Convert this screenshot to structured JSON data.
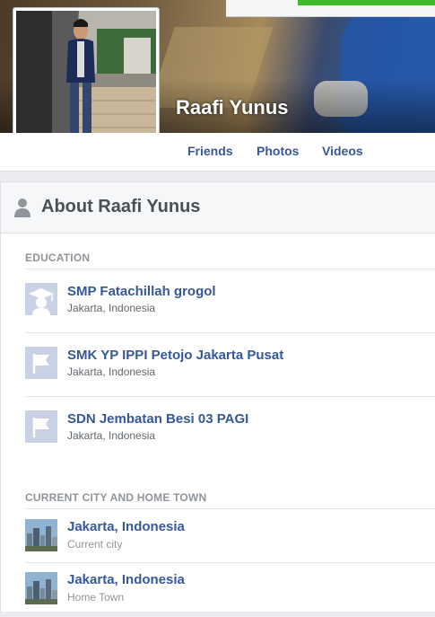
{
  "profile": {
    "name": "Raafi Yunus"
  },
  "nav": {
    "tabs": [
      {
        "label": "Friends"
      },
      {
        "label": "Photos"
      },
      {
        "label": "Videos"
      }
    ]
  },
  "about": {
    "title": "About Raafi Yunus",
    "education": {
      "heading": "EDUCATION",
      "items": [
        {
          "school": "SMP Fatachillah grogol",
          "location": "Jakarta, Indonesia",
          "icon": "graduate-icon"
        },
        {
          "school": "SMK YP IPPI Petojo Jakarta Pusat",
          "location": "Jakarta, Indonesia",
          "icon": "flag-icon"
        },
        {
          "school": "SDN Jembatan Besi 03 PAGI",
          "location": "Jakarta, Indonesia",
          "icon": "flag-icon"
        }
      ]
    },
    "places": {
      "heading": "CURRENT CITY AND HOME TOWN",
      "items": [
        {
          "place": "Jakarta, Indonesia",
          "type": "Current city"
        },
        {
          "place": "Jakarta, Indonesia",
          "type": "Home Town"
        }
      ]
    }
  },
  "colors": {
    "link": "#365899",
    "background": "#e9ebee",
    "icon_bg": "#c9d2e4"
  }
}
